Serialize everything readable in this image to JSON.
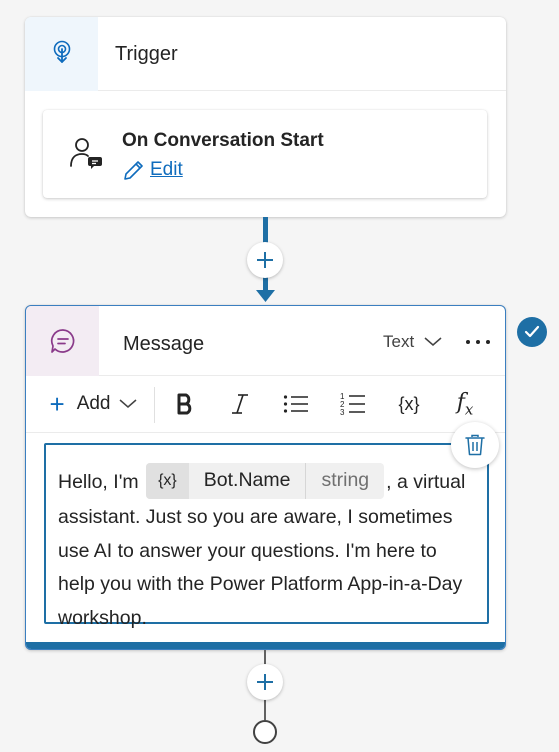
{
  "trigger": {
    "title": "Trigger",
    "icon": "trigger-icon",
    "event": {
      "title": "On Conversation Start",
      "edit_label": "Edit",
      "icon": "conversation-start-icon"
    }
  },
  "message": {
    "title": "Message",
    "icon": "message-icon",
    "type_label": "Text",
    "status": "valid",
    "toolbar": {
      "add_label": "Add",
      "buttons": [
        "bold",
        "italic",
        "bulleted-list",
        "numbered-list",
        "insert-variable",
        "formula"
      ]
    },
    "content": {
      "text_before": "Hello, I'm ",
      "variable": {
        "icon_text": "{x}",
        "name": "Bot.Name",
        "type": "string"
      },
      "text_after": ", a virtual assistant. Just so you are aware, I sometimes use AI to answer your questions. I'm here to help you with the Power Platform App-in-a-Day workshop."
    }
  },
  "colors": {
    "accent": "#1e6fa5",
    "link": "#0f6cbd",
    "trigger_header_bg": "#eff6fc",
    "message_header_bg": "#f3ecf3"
  }
}
